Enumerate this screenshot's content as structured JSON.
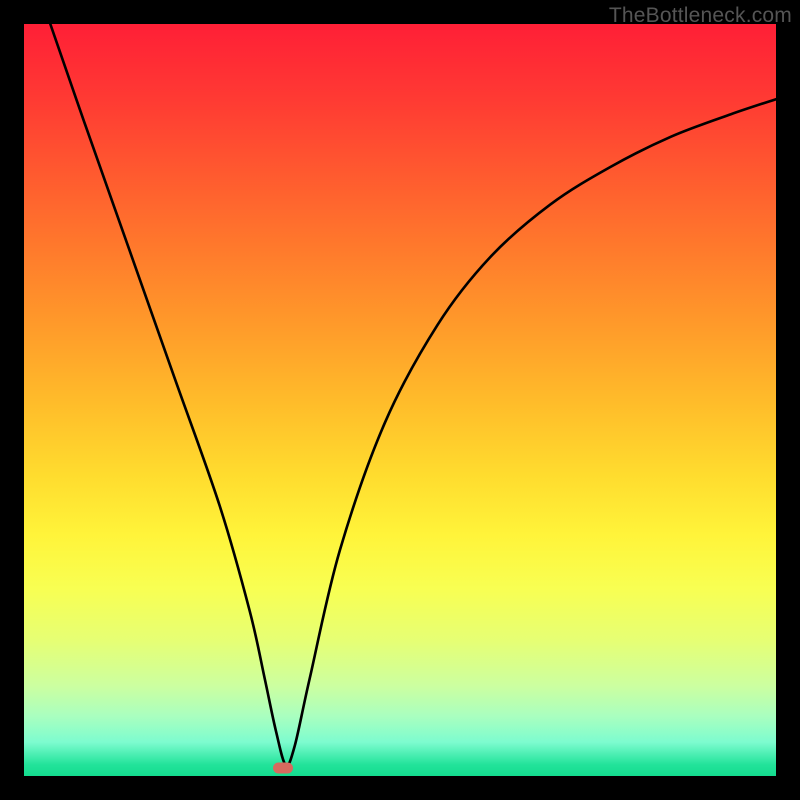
{
  "watermark": "TheBottleneck.com",
  "colors": {
    "frame_bg": "#000000",
    "curve": "#000000",
    "marker": "#d66a5e",
    "gradient_stops": [
      {
        "offset": 0.0,
        "color": "#ff1f36"
      },
      {
        "offset": 0.1,
        "color": "#ff3a33"
      },
      {
        "offset": 0.2,
        "color": "#ff5a2f"
      },
      {
        "offset": 0.3,
        "color": "#ff7a2c"
      },
      {
        "offset": 0.4,
        "color": "#ff9a2a"
      },
      {
        "offset": 0.5,
        "color": "#ffbb2a"
      },
      {
        "offset": 0.6,
        "color": "#ffdc2e"
      },
      {
        "offset": 0.68,
        "color": "#fff43a"
      },
      {
        "offset": 0.75,
        "color": "#f8ff52"
      },
      {
        "offset": 0.82,
        "color": "#e6ff74"
      },
      {
        "offset": 0.88,
        "color": "#ccffa0"
      },
      {
        "offset": 0.92,
        "color": "#aaffbf"
      },
      {
        "offset": 0.955,
        "color": "#7dfccf"
      },
      {
        "offset": 0.985,
        "color": "#22e39a"
      },
      {
        "offset": 1.0,
        "color": "#14db8f"
      }
    ]
  },
  "chart_data": {
    "type": "line",
    "title": "",
    "xlabel": "",
    "ylabel": "",
    "xlim": [
      0,
      100
    ],
    "ylim": [
      0,
      100
    ],
    "grid": false,
    "legend": false,
    "series": [
      {
        "name": "bottleneck-curve",
        "x": [
          3.5,
          8,
          14,
          20,
          26,
          30,
          32,
          33.5,
          34.8,
          36,
          38,
          42,
          48,
          55,
          62,
          70,
          78,
          86,
          94,
          100
        ],
        "y": [
          100,
          87,
          70,
          53,
          36,
          22,
          13,
          6,
          1.5,
          4,
          13,
          30,
          47,
          60,
          69,
          76,
          81,
          85,
          88,
          90
        ]
      }
    ],
    "marker": {
      "x": 34.5,
      "y": 1.0
    },
    "notes": "Values are approximate — the figure has no axes or tick labels; x and y are expressed as percentages of the plot area width/height. The curve is a V-shaped dip reaching ~0 near x≈34% and rising steeply on both sides over a vertical red→green gradient background."
  }
}
